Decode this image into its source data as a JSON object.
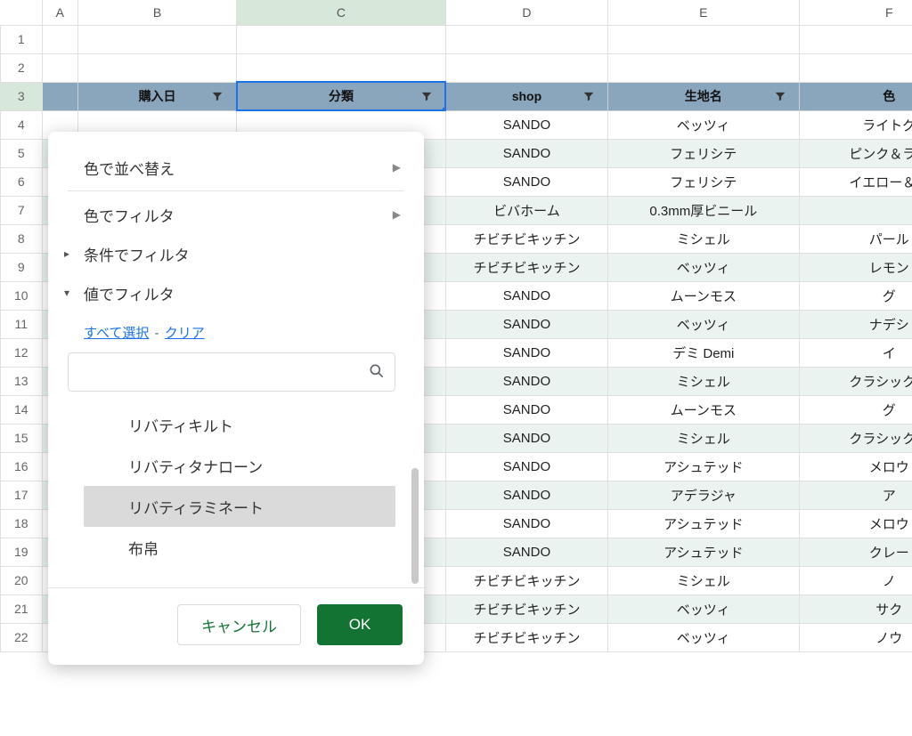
{
  "columns": [
    "A",
    "B",
    "C",
    "D",
    "E",
    "F"
  ],
  "selected_col": "C",
  "selected_row": 3,
  "row_numbers": [
    1,
    2,
    3,
    4,
    5,
    6,
    7,
    8,
    9,
    10,
    11,
    12,
    13,
    14,
    15,
    16,
    17,
    18,
    19,
    20,
    21,
    22
  ],
  "header": {
    "B": "購入日",
    "C": "分類",
    "D": "shop",
    "E": "生地名",
    "F": "色"
  },
  "rows": [
    {
      "D": "SANDO",
      "E": "ベッツィ",
      "F": "ライトグ"
    },
    {
      "D": "SANDO",
      "E": "フェリシテ",
      "F": "ピンク＆ライ"
    },
    {
      "D": "SANDO",
      "E": "フェリシテ",
      "F": "イエロー＆ラ"
    },
    {
      "D": "ビバホーム",
      "E": "0.3mm厚ビニール",
      "F": ""
    },
    {
      "D": "チビチビキッチン",
      "E": "ミシェル",
      "F": "パール"
    },
    {
      "D": "チビチビキッチン",
      "E": "ベッツィ",
      "F": "レモン"
    },
    {
      "D": "SANDO",
      "E": "ムーンモス",
      "F": "グ"
    },
    {
      "D": "SANDO",
      "E": "ベッツィ",
      "F": "ナデシ"
    },
    {
      "D": "SANDO",
      "E": "デミ Demi",
      "F": "イ"
    },
    {
      "D": "SANDO",
      "E": "ミシェル",
      "F": "クラシックピ"
    },
    {
      "D": "SANDO",
      "E": "ムーンモス",
      "F": "グ"
    },
    {
      "D": "SANDO",
      "E": "ミシェル",
      "F": "クラシックピ"
    },
    {
      "D": "SANDO",
      "E": "アシュテッド",
      "F": "メロウ"
    },
    {
      "D": "SANDO",
      "E": "アデラジャ",
      "F": "ア"
    },
    {
      "D": "SANDO",
      "E": "アシュテッド",
      "F": "メロウ"
    },
    {
      "D": "SANDO",
      "E": "アシュテッド",
      "F": "クレー"
    },
    {
      "D": "チビチビキッチン",
      "E": "ミシェル",
      "F": "ノ"
    },
    {
      "D": "チビチビキッチン",
      "E": "ベッツィ",
      "F": "サク"
    },
    {
      "D": "チビチビキッチン",
      "E": "ベッツィ",
      "F": "ノウ"
    }
  ],
  "filter_popup": {
    "sort_by_color": "色で並べ替え",
    "filter_by_color": "色でフィルタ",
    "filter_by_condition": "条件でフィルタ",
    "filter_by_values": "値でフィルタ",
    "select_all": "すべて選択",
    "clear": "クリア",
    "dash": " - ",
    "search_placeholder": "",
    "values": [
      {
        "label": "リバティキルト",
        "selected": false
      },
      {
        "label": "リバティタナローン",
        "selected": false
      },
      {
        "label": "リバティラミネート",
        "selected": true
      },
      {
        "label": "布帛",
        "selected": false
      }
    ],
    "cancel": "キャンセル",
    "ok": "OK"
  }
}
